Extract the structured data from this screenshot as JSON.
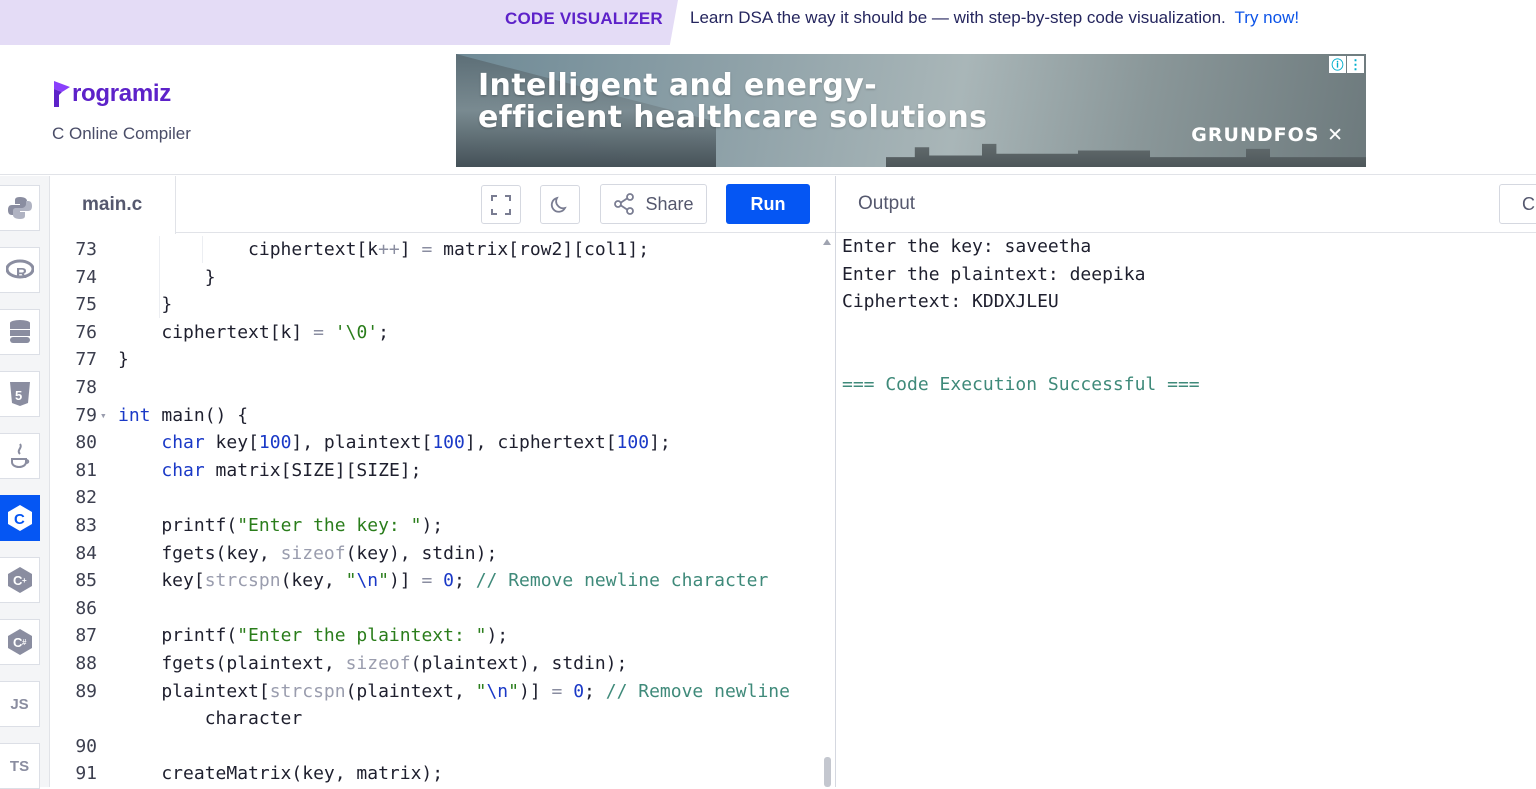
{
  "promo": {
    "brand": "CODE VISUALIZER",
    "text": "Learn DSA the way it should be — with step-by-step code visualization.",
    "link": "Try now!"
  },
  "header": {
    "logo": "rogramiz",
    "subtitle": "C Online Compiler"
  },
  "ad": {
    "headline_1": "Intelligent and energy-",
    "headline_2": "efficient healthcare solutions",
    "brand": "GRUNDFOS",
    "info_icon": "info-icon",
    "menu_icon": "kebab-menu-icon"
  },
  "sidebar": {
    "items": [
      {
        "name": "python-icon"
      },
      {
        "name": "r-icon"
      },
      {
        "name": "sql-icon"
      },
      {
        "name": "html5-icon"
      },
      {
        "name": "java-icon"
      },
      {
        "name": "c-icon",
        "active": true
      },
      {
        "name": "cplusplus-icon"
      },
      {
        "name": "csharp-icon"
      },
      {
        "name": "js-icon",
        "label": "JS"
      },
      {
        "name": "ts-icon",
        "label": "TS"
      }
    ]
  },
  "editor": {
    "file_tab": "main.c",
    "share_label": "Share",
    "run_label": "Run",
    "lines": [
      {
        "n": "73",
        "text": "            ciphertext[k++] = matrix[row2][col1];"
      },
      {
        "n": "74",
        "text": "        }"
      },
      {
        "n": "75",
        "text": "    }"
      },
      {
        "n": "76",
        "text": "    ciphertext[k] = '\\0';"
      },
      {
        "n": "77",
        "text": "}"
      },
      {
        "n": "78",
        "text": ""
      },
      {
        "n": "79",
        "text": "int main() {"
      },
      {
        "n": "80",
        "text": "    char key[100], plaintext[100], ciphertext[100];"
      },
      {
        "n": "81",
        "text": "    char matrix[SIZE][SIZE];"
      },
      {
        "n": "82",
        "text": ""
      },
      {
        "n": "83",
        "text": "    printf(\"Enter the key: \");"
      },
      {
        "n": "84",
        "text": "    fgets(key, sizeof(key), stdin);"
      },
      {
        "n": "85",
        "text": "    key[strcspn(key, \"\\n\")] = 0; // Remove newline character"
      },
      {
        "n": "86",
        "text": ""
      },
      {
        "n": "87",
        "text": "    printf(\"Enter the plaintext: \");"
      },
      {
        "n": "88",
        "text": "    fgets(plaintext, sizeof(plaintext), stdin);"
      },
      {
        "n": "89",
        "text": "    plaintext[strcspn(plaintext, \"\\n\")] = 0; // Remove newline"
      },
      {
        "n": "",
        "text": "        character"
      },
      {
        "n": "90",
        "text": ""
      },
      {
        "n": "91",
        "text": "    createMatrix(key, matrix);"
      }
    ]
  },
  "output": {
    "title": "Output",
    "clear_label": "Clear",
    "lines": [
      "Enter the key: saveetha",
      "Enter the plaintext: deepika",
      "Ciphertext: KDDXJLEU",
      "",
      "",
      "=== Code Execution Successful ==="
    ]
  },
  "colors": {
    "brand_purple": "#5d22c9",
    "run_blue": "#0556f3",
    "promo_bg": "#e4dcf6"
  }
}
